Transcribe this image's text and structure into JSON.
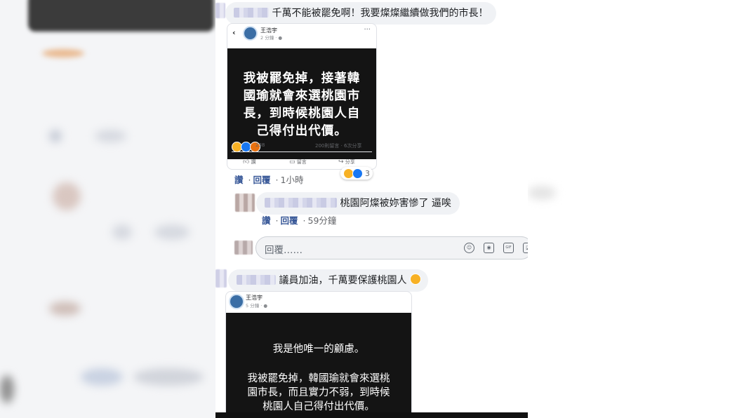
{
  "comment1": {
    "text": "千萬不能被罷免啊！我要燦燦繼續做我們的市長！",
    "embed": {
      "author": "王浩宇",
      "time": "2 分鐘 · ",
      "image_text": [
        "我被罷免掉，接著韓",
        "國瑜就會來選桃園市",
        "長，到時候桃園人自",
        "己得付出代價。"
      ],
      "reaction_count": "238",
      "stats": "200則留言 · 6次分享",
      "actions": {
        "like": "讚",
        "comment": "留言",
        "share": "分享"
      }
    },
    "meta": {
      "like": "讚",
      "reply": "回覆",
      "time": "1小時"
    },
    "reaction_pill_count": "3"
  },
  "reply1": {
    "text": "桃園阿燦被妳害慘了 逼唉",
    "meta": {
      "like": "讚",
      "reply": "回覆",
      "time": "59分鐘"
    }
  },
  "reply_input": {
    "placeholder": "回覆……"
  },
  "comment2": {
    "text": "議員加油，千萬要保護桃園人",
    "embed": {
      "author": "王浩宇",
      "time": "5 分鐘 · ",
      "line1": "我是他唯一的顧慮。",
      "line2": [
        "我被罷免掉，韓國瑜就會來選桃",
        "園市長，而且實力不弱，到時候",
        "桃園人自己得付出代價。"
      ]
    }
  },
  "colors": {
    "link": "#385898",
    "bubble": "#f0f2f5",
    "muted": "#65676b"
  }
}
